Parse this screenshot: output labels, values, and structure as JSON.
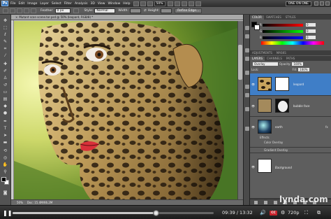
{
  "menubar": {
    "logo": "Ps",
    "items": [
      "File",
      "Edit",
      "Image",
      "Layer",
      "Select",
      "Filter",
      "Analysis",
      "3D",
      "View",
      "Window",
      "Help"
    ],
    "zoom": "50%",
    "workspace": "ONE ON ONE"
  },
  "options": {
    "feather_label": "Feather:",
    "feather_value": "0 px",
    "style_label": "Style:",
    "style_value": "Normal",
    "width_label": "Width:",
    "height_label": "Height:",
    "refine_label": "Refine Edge..."
  },
  "document": {
    "tab_title": "Mutant scan scene.tor.psd @ 50% (leopard, RGB/8) *",
    "status_zoom": "50%",
    "status_doc": "Doc: 15.4M/66.2M"
  },
  "panels": {
    "color_tabs": [
      "COLOR",
      "SWATCHES",
      "STYLES"
    ],
    "color_values": {
      "R": "0",
      "G": "0",
      "B": "0"
    },
    "adjust_tabs": [
      "ADJUSTMENTS",
      "MASKS"
    ],
    "layer_tabs": [
      "LAYERS",
      "CHANNELS",
      "PATHS"
    ],
    "blend_mode": "Overlay",
    "opacity_label": "Opacity:",
    "opacity_value": "100%",
    "lock_label": "Lock:",
    "fill_label": "Fill:",
    "fill_value": "100%",
    "layers": [
      {
        "name": "leopard",
        "selected": true
      },
      {
        "name": "bubble face",
        "selected": false
      },
      {
        "name": "earth",
        "selected": false
      },
      {
        "name": "Background",
        "selected": false
      }
    ],
    "effects_label": "Effects",
    "effects": [
      "Color Overlay",
      "Gradient Overlay"
    ]
  },
  "player": {
    "elapsed": "09:39",
    "total": "13:32",
    "timecode": "09:39 / 13:32",
    "progress": 0.713,
    "cc": "CC",
    "quality": "720p",
    "watermark": "lynda.com"
  },
  "colors": {
    "accent": "#3f7ec7",
    "cc": "#c8232c"
  }
}
